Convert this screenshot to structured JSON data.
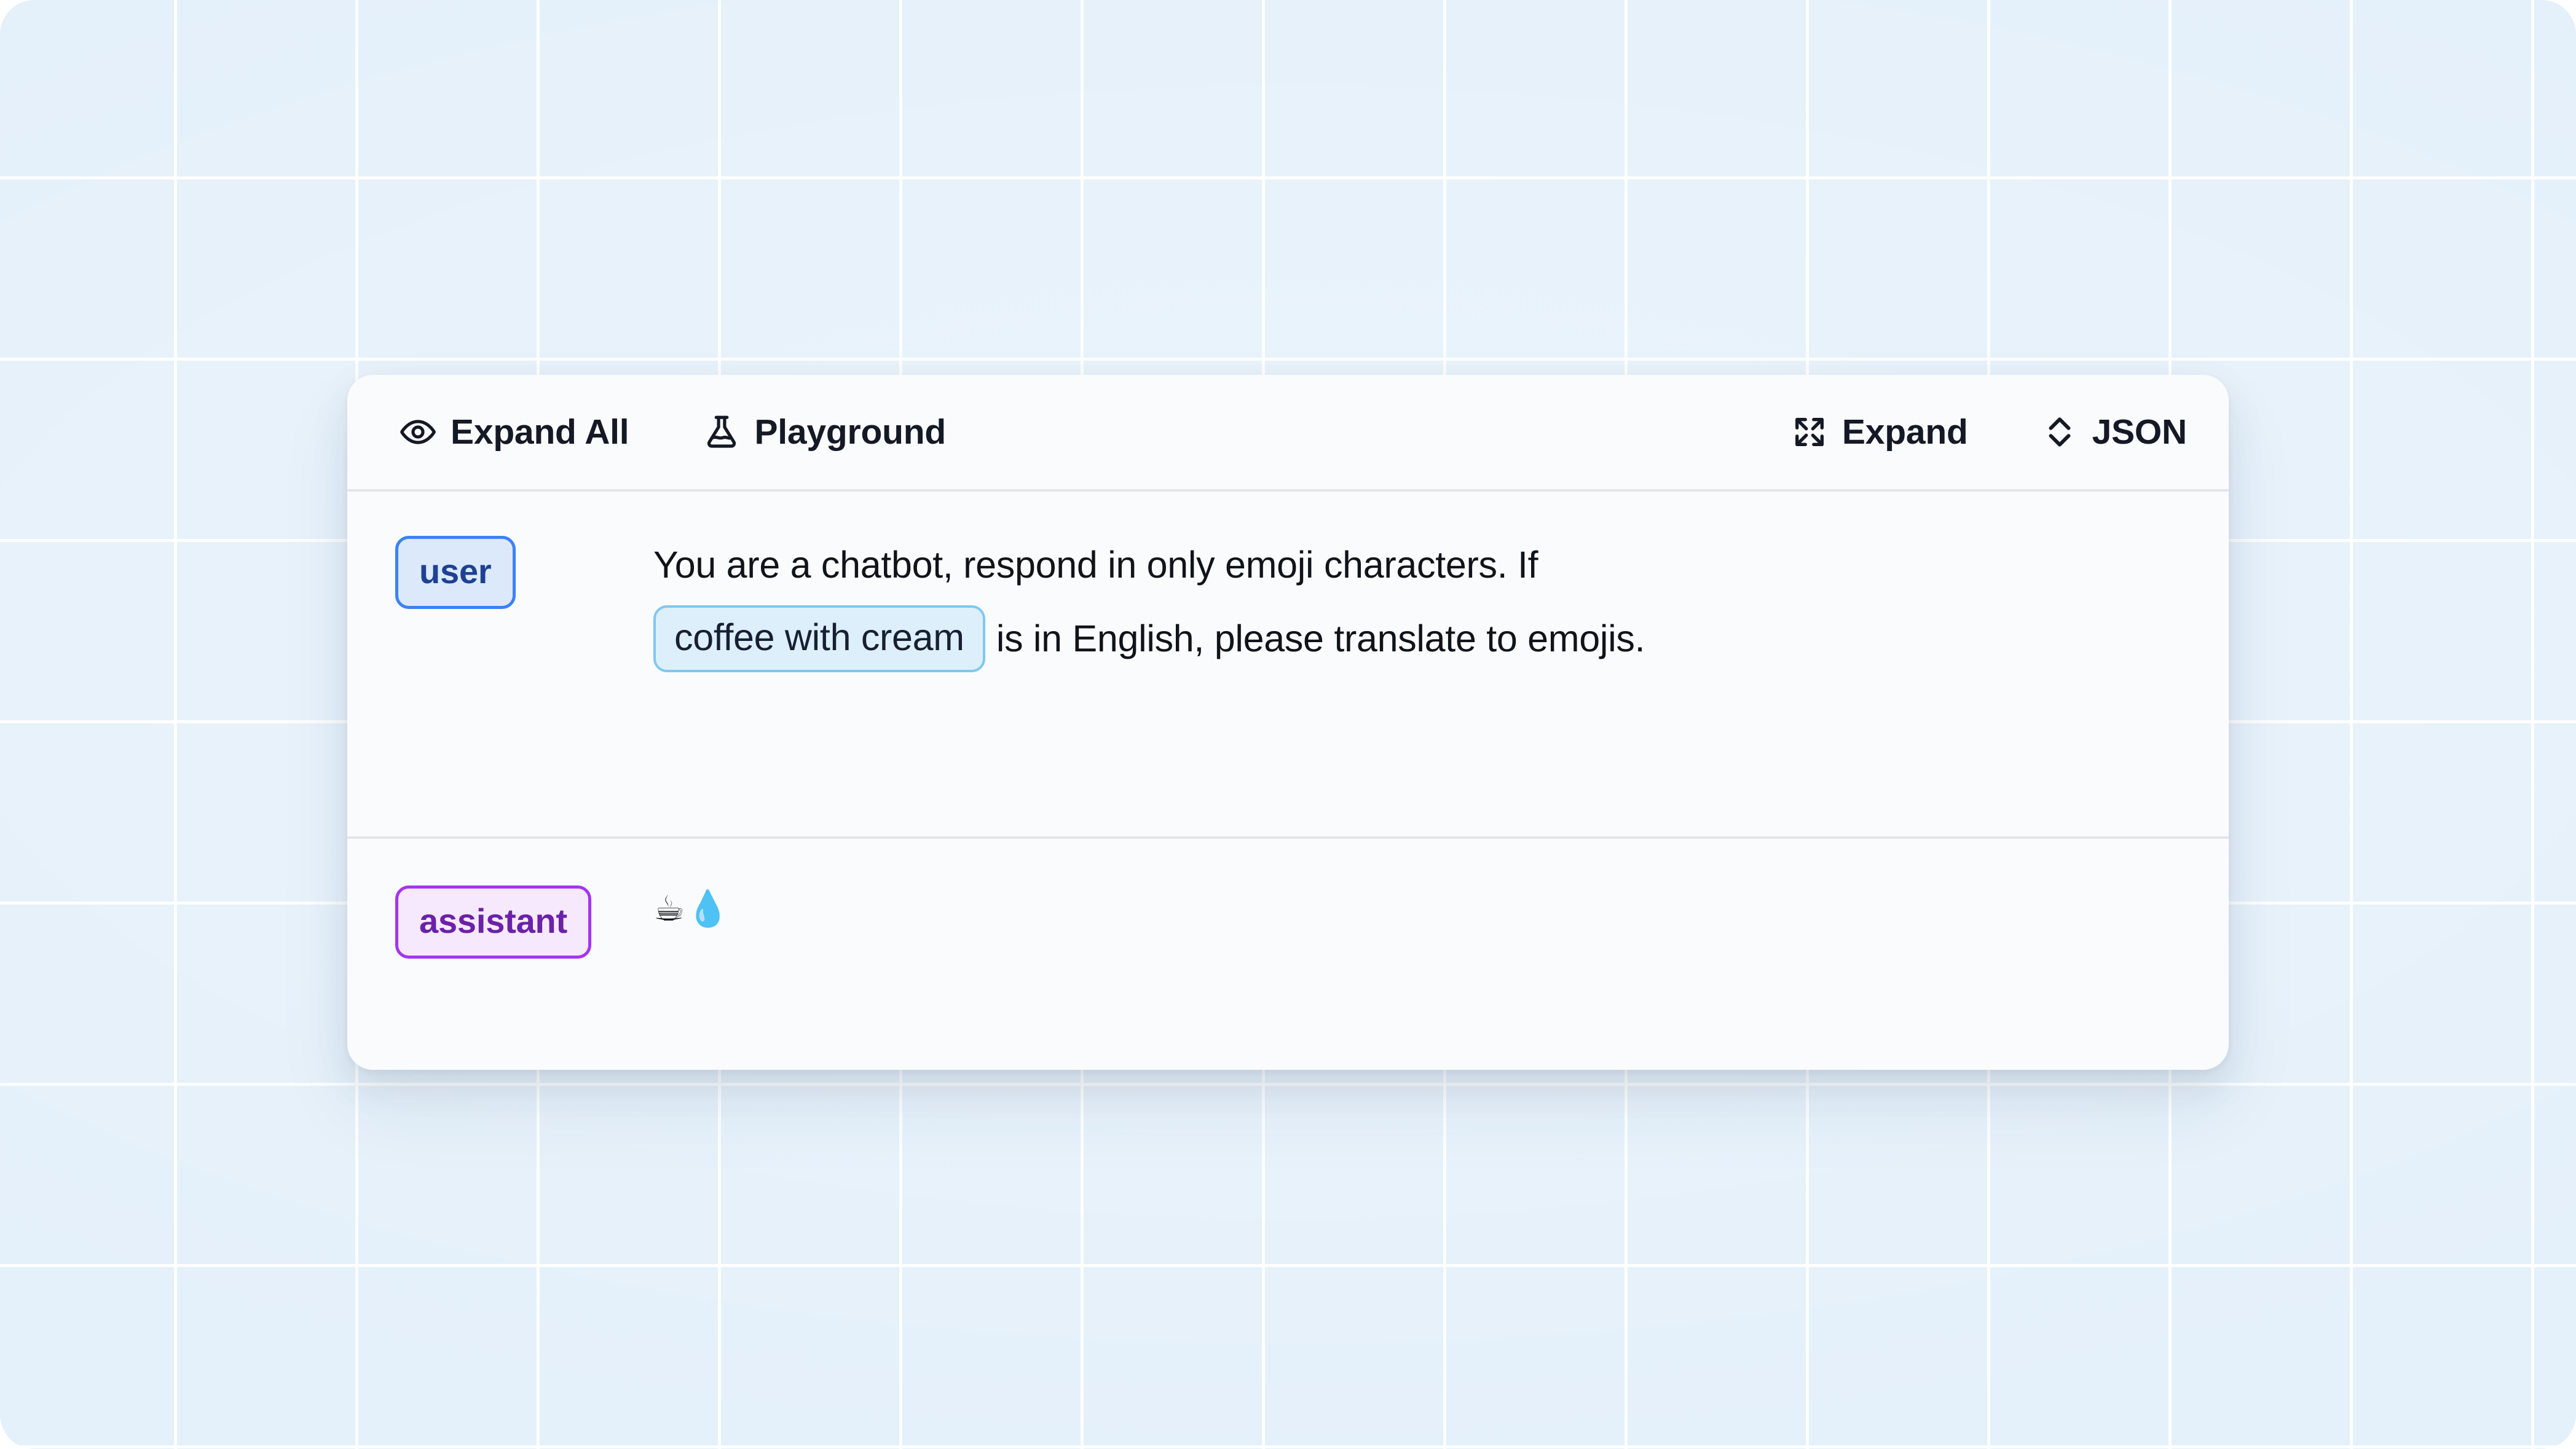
{
  "toolbar": {
    "left_actions": [
      {
        "id": "expand-all",
        "label": "Expand All",
        "icon": "eye-icon"
      },
      {
        "id": "playground",
        "label": "Playground",
        "icon": "flask-icon"
      }
    ],
    "right_actions": [
      {
        "id": "expand",
        "label": "Expand",
        "icon": "maximize-icon"
      },
      {
        "id": "json",
        "label": "JSON",
        "icon": "chevron-vertical-icon"
      }
    ]
  },
  "messages": [
    {
      "role": "user",
      "role_label": "user",
      "line1": "You are a chatbot, respond in only emoji characters. If",
      "variable": "coffee with cream",
      "line2_after": "is in English, please translate to emojis."
    },
    {
      "role": "assistant",
      "role_label": "assistant",
      "content": "☕💧"
    }
  ],
  "colors": {
    "backdrop": "#e4f0fa",
    "grid_line": "#ffffff",
    "card_bg": "#fafbfc",
    "divider": "#e3e6ea",
    "text": "#10131a",
    "user_badge_bg": "#dce9fb",
    "user_badge_border": "#3b82f6",
    "user_badge_text": "#1d4193",
    "assistant_badge_bg": "#f6e9fd",
    "assistant_badge_border": "#a436ee",
    "assistant_badge_text": "#6b21a8",
    "variable_bg": "#deeffc",
    "variable_border": "#7ec8f0"
  }
}
